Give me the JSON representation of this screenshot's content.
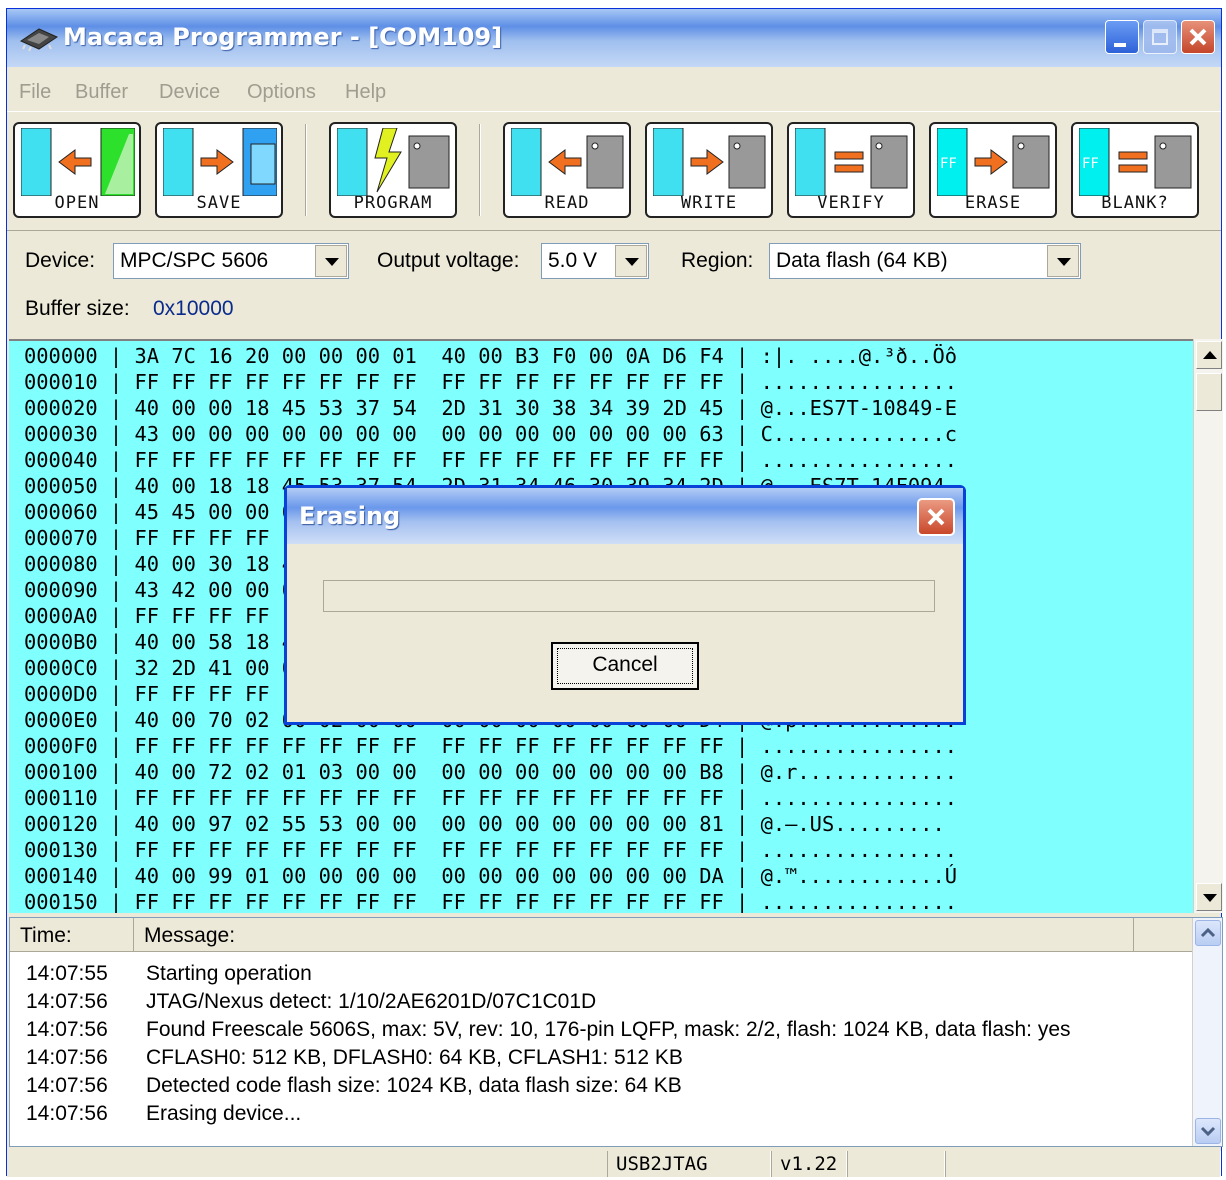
{
  "window": {
    "title": "Macaca Programmer - [COM109]"
  },
  "menu": [
    "File",
    "Buffer",
    "Device",
    "Options",
    "Help"
  ],
  "toolbar": {
    "open": "OPEN",
    "save": "SAVE",
    "program": "PROGRAM",
    "read": "READ",
    "write": "WRITE",
    "verify": "VERIFY",
    "erase": "ERASE",
    "blank": "BLANK?",
    "ff_label": "FF"
  },
  "settings": {
    "device_label": "Device:",
    "device_value": "MPC/SPC 5606",
    "voltage_label": "Output voltage:",
    "voltage_value": "5.0 V",
    "region_label": "Region:",
    "region_value": "Data flash (64 KB)",
    "buffer_label": "Buffer size:",
    "buffer_value": "0x10000"
  },
  "hex_lines": [
    "000000 | 3A 7C 16 20 00 00 00 01  40 00 B3 F0 00 0A D6 F4 | :|. ....@.³ð..Öô",
    "000010 | FF FF FF FF FF FF FF FF  FF FF FF FF FF FF FF FF | ................",
    "000020 | 40 00 00 18 45 53 37 54  2D 31 30 38 34 39 2D 45 | @...ES7T-10849-E",
    "000030 | 43 00 00 00 00 00 00 00  00 00 00 00 00 00 00 63 | C..............c",
    "000040 | FF FF FF FF FF FF FF FF  FF FF FF FF FF FF FF FF | ................",
    "000050 | 40 00 18 18 45 53 37 54  2D 31 34 46 30 39 34 2D | @...ES7T-14F094-",
    "000060 | 45 45 00 00 00 00 00 00  00 00 00 00 00 00 00 BE | EE.............¾",
    "000070 | FF FF FF FF FF FF FF FF  FF FF FF FF FF FF FF FF | ................",
    "000080 | 40 00 30 18 45 53 37 54  2D 31 34 43 30 38 38 2D | @.0.ES7T-14C088-",
    "000090 | 43 42 00 00 00 00 00 00  00 00 00 00 00 00 00 D4 | CB.............Ô",
    "0000A0 | FF FF FF FF FF FF FF FF  FF FF FF FF FF FF FF FF | ................",
    "0000B0 | 40 00 58 18 45 53 37 54  2D 31 41 32 39 00 00 00 | @.X.ES7T-1A29...",
    "0000C0 | 32 2D 41 00 00 00 00 00  00 00 00 00 00 00 00 83 | 2-A............ƒ",
    "0000D0 | FF FF FF FF FF FF FF FF  FF FF FF FF FF FF FF FF | ................",
    "0000E0 | 40 00 70 02 00 02 00 00  00 00 00 00 00 00 00 D4 | @.p.............",
    "0000F0 | FF FF FF FF FF FF FF FF  FF FF FF FF FF FF FF FF | ................",
    "000100 | 40 00 72 02 01 03 00 00  00 00 00 00 00 00 00 B8 | @.r.............",
    "000110 | FF FF FF FF FF FF FF FF  FF FF FF FF FF FF FF FF | ................",
    "000120 | 40 00 97 02 55 53 00 00  00 00 00 00 00 00 00 81 | @.—.US.........",
    "000130 | FF FF FF FF FF FF FF FF  FF FF FF FF FF FF FF FF | ................",
    "000140 | 40 00 99 01 00 00 00 00  00 00 00 00 00 00 00 DA | @.™............Ú",
    "000150 | FF FF FF FF FF FF FF FF  FF FF FF FF FF FF FF FF | ................"
  ],
  "log": {
    "time_header": "Time:",
    "message_header": "Message:",
    "rows": [
      {
        "time": "14:07:55",
        "message": "Starting operation"
      },
      {
        "time": "14:07:56",
        "message": "JTAG/Nexus detect: 1/10/2AE6201D/07C1C01D"
      },
      {
        "time": "14:07:56",
        "message": "Found Freescale 5606S, max: 5V, rev: 10, 176-pin LQFP, mask: 2/2, flash: 1024 KB, data flash: yes"
      },
      {
        "time": "14:07:56",
        "message": "CFLASH0: 512 KB, DFLASH0: 64 KB, CFLASH1: 512 KB"
      },
      {
        "time": "14:07:56",
        "message": "Detected code flash size: 1024 KB, data flash size: 64 KB"
      },
      {
        "time": "14:07:56",
        "message": "Erasing device..."
      }
    ]
  },
  "status": {
    "interface": "USB2JTAG",
    "version": "v1.22"
  },
  "dialog": {
    "title": "Erasing",
    "cancel": "Cancel",
    "progress": 0
  },
  "colors": {
    "hex_background": "#80ffff",
    "title_bar": "#5e8fe6",
    "chip_buffer": "#40e0f0",
    "arrow": "#f07020"
  }
}
